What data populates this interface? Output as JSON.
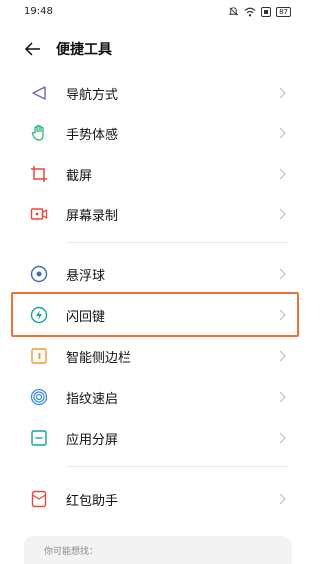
{
  "status": {
    "time": "19:48",
    "battery": "87"
  },
  "header": {
    "title": "便捷工具"
  },
  "items": [
    {
      "label": "导航方式",
      "icon": "navigation-arrow-icon"
    },
    {
      "label": "手势体感",
      "icon": "hand-gesture-icon"
    },
    {
      "label": "截屏",
      "icon": "crop-screenshot-icon"
    },
    {
      "label": "屏幕录制",
      "icon": "video-record-icon"
    },
    {
      "label": "悬浮球",
      "icon": "floating-ball-icon"
    },
    {
      "label": "闪回键",
      "icon": "flashback-key-icon"
    },
    {
      "label": "智能侧边栏",
      "icon": "smart-sidebar-icon"
    },
    {
      "label": "指纹速启",
      "icon": "fingerprint-icon"
    },
    {
      "label": "应用分屏",
      "icon": "split-screen-icon"
    },
    {
      "label": "红包助手",
      "icon": "red-envelope-icon"
    }
  ],
  "suggest": {
    "label": "你可能想找："
  },
  "colors": {
    "highlight": "#e8743b",
    "icon_purple": "#6b6bb8",
    "icon_green": "#26b36e",
    "icon_red": "#e8473a",
    "icon_orange": "#f29b2d",
    "icon_blue": "#3a8de0",
    "icon_teal": "#16a69a"
  }
}
